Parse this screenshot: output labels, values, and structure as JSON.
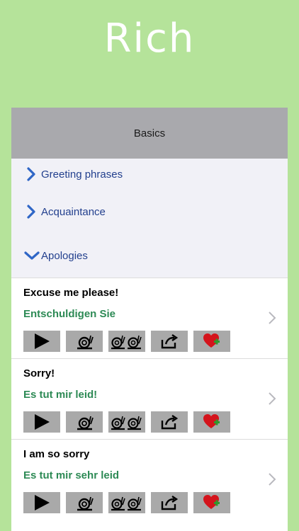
{
  "app": {
    "brand_title": "Rich"
  },
  "section": {
    "title": "Basics"
  },
  "categories": [
    {
      "label": "Greeting phrases",
      "state": "collapsed",
      "icon": "chevron-right-icon"
    },
    {
      "label": "Acquaintance",
      "state": "collapsed",
      "icon": "chevron-right-icon"
    },
    {
      "label": "Apologies",
      "state": "expanded",
      "icon": "chevron-down-icon"
    }
  ],
  "phrases": [
    {
      "english": "Excuse me please!",
      "german": "Entschuldigen Sie"
    },
    {
      "english": "Sorry!",
      "german": "Es tut mir leid!"
    },
    {
      "english": "I am so sorry",
      "german": "Es tut mir sehr leid"
    }
  ],
  "controls": [
    {
      "icon": "play-icon"
    },
    {
      "icon": "snail-slow-icon"
    },
    {
      "icon": "double-snail-slower-icon"
    },
    {
      "icon": "share-icon"
    },
    {
      "icon": "favorite-heart-icon"
    }
  ],
  "colors": {
    "background": "#b5e39a",
    "header": "#a9a9ad",
    "category_text": "#23408e",
    "translation_text": "#2d8a55",
    "button_bg": "#a9a9a9"
  }
}
